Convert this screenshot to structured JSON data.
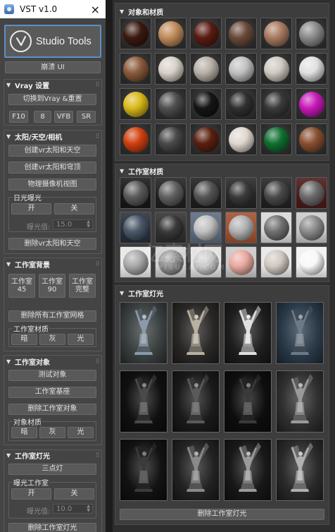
{
  "window": {
    "title": "VST v1.0",
    "close_glyph": "×"
  },
  "logo": {
    "label": "Studio Tools"
  },
  "crash_ui": "崩溃 UI",
  "vray": {
    "title": "Vray 设置",
    "switch_label": "切换到Vray &重置",
    "buttons": [
      "F10",
      "8",
      "VFB",
      "SR"
    ]
  },
  "sun": {
    "title": "太阳/天空/相机",
    "create_sun_sky": "创建vr太阳和天空",
    "create_sun_dome": "创建vr太阳和穹顶",
    "camera_view": "物理摄像机视图",
    "daylight_label": "日光曝光",
    "on": "开",
    "off": "关",
    "exposure_label": "曝光值:",
    "exposure_value": "15.0",
    "delete_label": "删除vr太阳和天空"
  },
  "studio_bg": {
    "title": "工作室背景",
    "bg_buttons": [
      {
        "l1": "工作室",
        "l2": "45"
      },
      {
        "l1": "工作室",
        "l2": "90"
      },
      {
        "l1": "工作室",
        "l2": "完整"
      }
    ],
    "delete_mesh": "删除所有工作室网格",
    "material_label": "工作室材质",
    "mats": [
      "暗",
      "灰",
      "光"
    ]
  },
  "studio_obj": {
    "title": "工作室对象",
    "test_obj": "测试对象",
    "pedestal": "工作室基座",
    "delete_obj": "删除工作室对象",
    "material_label": "对象材质",
    "mats": [
      "暗",
      "灰",
      "光"
    ]
  },
  "studio_light": {
    "title": "工作室灯光",
    "three_point": "三点灯",
    "exposure_group": "曝光工作室",
    "on": "开",
    "off": "关",
    "exposure_label": "曝光值:",
    "exposure_value": "10.0",
    "delete_label": "删除工作室灯光"
  },
  "right": {
    "objects_materials_title": "对象和材质",
    "studio_materials_title": "工作室材质",
    "studio_lights_title": "工作室灯光",
    "delete_lights": "删除工作室灯光"
  },
  "watermark": {
    "brand": "亿素材网",
    "domain": "YISUCAI.COM"
  },
  "colors": {
    "accent_border": "#5d8fc4",
    "panel_bg": "#444444",
    "button_bg": "#595959"
  },
  "object_spheres": [
    "#3a1a10",
    "#c08a5a",
    "#5a1c12",
    "#6a4a3a",
    "#a87a60",
    "#8a8a8a",
    "#8a5a3a",
    "#d8d0c8",
    "#b8b0a8",
    "#c0c0c0",
    "#cfc8c0",
    "#e0e0e0",
    "#d8b818",
    "#505050",
    "#151515",
    "#303030",
    "#3a3a3a",
    "#c818b8",
    "#d04010",
    "#4a4a4a",
    "#5a2010",
    "#e0d8d0",
    "#107030",
    "#8a5030"
  ],
  "studio_spheres": [
    {
      "bg": "#181818",
      "s": "#5a5a5a"
    },
    {
      "bg": "#202020",
      "s": "#606060"
    },
    {
      "bg": "#1e1e1e",
      "s": "#555555"
    },
    {
      "bg": "#262626",
      "s": "#3a3a3a"
    },
    {
      "bg": "#222222",
      "s": "#4a4a4a"
    },
    {
      "bg": "#4a1a1a",
      "s": "#6a6a6a"
    },
    {
      "bg": "#28303a",
      "s": "#4a5868"
    },
    {
      "bg": "#303030",
      "s": "#3a3a3a"
    },
    {
      "bg": "#5a6a80",
      "s": "#c0c0c0"
    },
    {
      "bg": "#a05030",
      "s": "#b0b0b0"
    },
    {
      "bg": "#d8d8d8",
      "s": "#707070"
    },
    {
      "bg": "#c8c8c8",
      "s": "#8a8a8a"
    },
    {
      "bg": "#e8e8e8",
      "s": "#a8a8a8"
    },
    {
      "bg": "#d0d0d0",
      "s": "#909090"
    },
    {
      "bg": "#e0e0e0",
      "s": "#c8c8c8"
    },
    {
      "bg": "#c8c8c8",
      "s": "#e8a8a0"
    },
    {
      "bg": "#e8e8e8",
      "s": "#d0c8c0"
    },
    {
      "bg": "#f0f0f0",
      "s": "#f8f8f8"
    }
  ],
  "light_cells": [
    {
      "bg": "#3a3f40",
      "fig": "#8a9aa8"
    },
    {
      "bg": "#2a2826",
      "fig": "#b8b0a0"
    },
    {
      "bg": "#1e1e1e",
      "fig": "#e0e0e0"
    },
    {
      "bg": "#2a3a48",
      "fig": "#6a7a88"
    },
    {
      "bg": "#101010",
      "fig": "#4a4a4a"
    },
    {
      "bg": "#1a1a1a",
      "fig": "#5a5a5a"
    },
    {
      "bg": "#0e0e0e",
      "fig": "#3a3a3a"
    },
    {
      "bg": "#303030",
      "fig": "#9a9a9a"
    },
    {
      "bg": "#121212",
      "fig": "#3a3a3a"
    },
    {
      "bg": "#222222",
      "fig": "#8a8a8a"
    },
    {
      "bg": "#181818",
      "fig": "#9a9a9a"
    },
    {
      "bg": "#2a2a2a",
      "fig": "#b0b0b0"
    }
  ]
}
